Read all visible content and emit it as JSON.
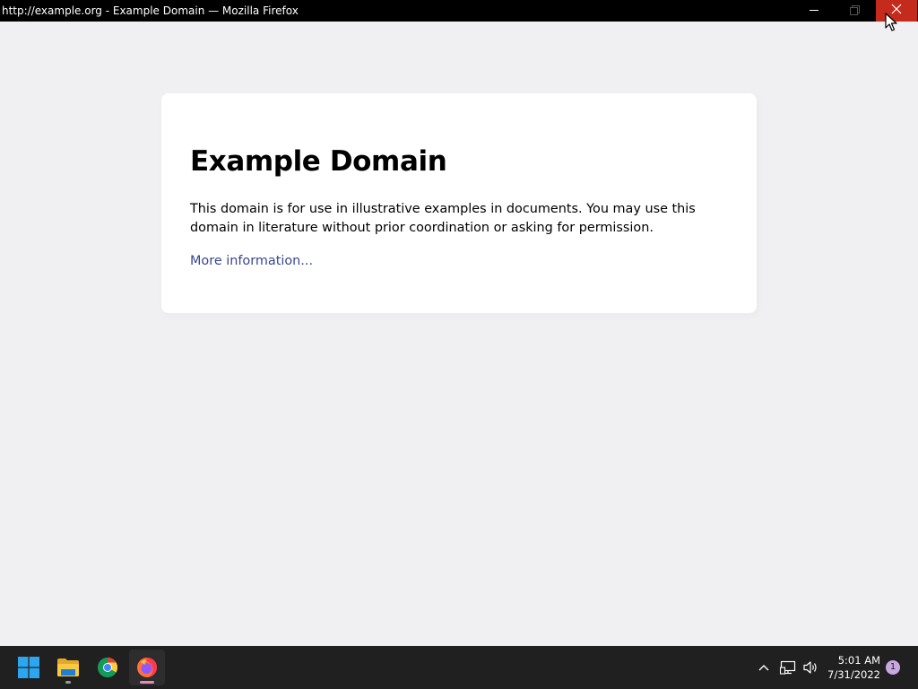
{
  "window": {
    "title": "http://example.org - Example Domain — Mozilla Firefox",
    "controls": [
      "minimize-icon",
      "maximize-icon",
      "close-icon"
    ],
    "close_hover_color": "#c42b1c"
  },
  "page": {
    "heading": "Example Domain",
    "description": "This domain is for use in illustrative examples in documents. You may use this domain in literature without prior coordination or asking for permission.",
    "link_text": "More information...",
    "background_color": "#f0f0f2",
    "link_color": "#38488f"
  },
  "taskbar": {
    "pinned": [
      {
        "name": "start",
        "icon": "windows-logo-icon"
      },
      {
        "name": "file-explorer",
        "icon": "folder-icon"
      },
      {
        "name": "chrome",
        "icon": "chrome-icon"
      },
      {
        "name": "firefox",
        "icon": "firefox-icon",
        "active": true
      }
    ],
    "tray": {
      "icons": [
        "chevron-up-icon",
        "network-icon",
        "volume-icon"
      ],
      "time": "5:01 AM",
      "date": "7/31/2022",
      "notification_count": "1"
    }
  }
}
